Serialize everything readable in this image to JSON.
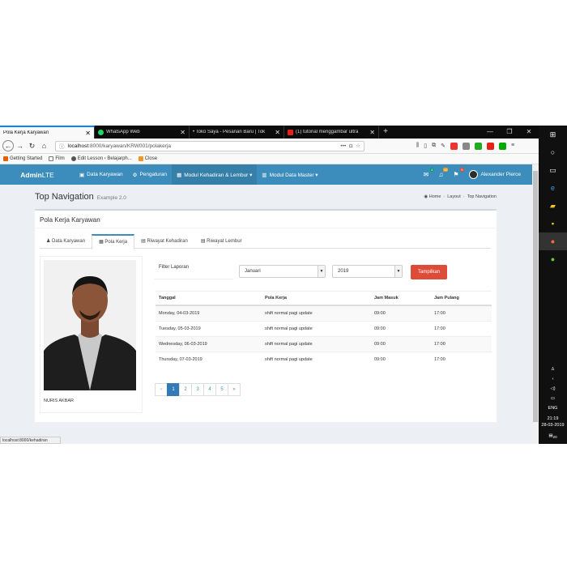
{
  "browser": {
    "tabs": [
      {
        "label": "Pola Kerja Karyawan",
        "active": true
      },
      {
        "label": "WhatsApp Web",
        "active": false
      },
      {
        "label": "• Toko Saya - Pesanan Baru | Tok",
        "active": false
      },
      {
        "label": "(1) tutorial menggambar ultra",
        "active": false
      }
    ],
    "url_host": "localhost",
    "url_path": ":8000/karyawan/KRW001/polakerja",
    "url_menu": "•••",
    "bookmarks": [
      "Getting Started",
      "Film",
      "Edit Lesson ‹ Belajarph...",
      "Close"
    ]
  },
  "header": {
    "logo_bold": "Admin",
    "logo_rest": "LTE",
    "menu": [
      {
        "label": "Data Karyawan",
        "active": false
      },
      {
        "label": "Pengaturan",
        "active": false
      },
      {
        "label": "Modul Kehadiran & Lembur ▾",
        "active": true
      },
      {
        "label": "Modul Data Master ▾",
        "active": false
      }
    ],
    "badges": {
      "mail": "4",
      "bell": "10",
      "flag": "9"
    },
    "user": "Alexander Pierce"
  },
  "page": {
    "title": "Top Navigation",
    "subtitle": "Example 2.0",
    "breadcrumb": [
      "Home",
      "Layout",
      "Top Navigation"
    ]
  },
  "box": {
    "title": "Pola Kerja Karyawan",
    "tabs": [
      {
        "label": "Data Karyawan",
        "active": false
      },
      {
        "label": "Pola Kerja",
        "active": true
      },
      {
        "label": "Riwayat Kehadiran",
        "active": false
      },
      {
        "label": "Riwayat Lembur",
        "active": false
      }
    ],
    "employee_name": "NURIS AKBAR",
    "filter_label": "Filter Laporan",
    "month": "Januari",
    "year": "2019",
    "show_button": "Tampilkan",
    "table": {
      "headers": [
        "Tanggal",
        "Pola Kerja",
        "Jam Masuk",
        "Jam Pulang"
      ],
      "rows": [
        [
          "Monday, 04-03-2019",
          "shift normal pagi update",
          "09:00",
          "17:00"
        ],
        [
          "Tuesday, 05-03-2019",
          "shift normal pagi update",
          "09:00",
          "17:00"
        ],
        [
          "Wednesday, 06-03-2019",
          "shift normal pagi update",
          "09:00",
          "17:00"
        ],
        [
          "Thursday, 07-03-2019",
          "shift normal pagi update",
          "09:00",
          "17:00"
        ]
      ]
    },
    "pagination": [
      "«",
      "1",
      "2",
      "3",
      "4",
      "5",
      "»"
    ]
  },
  "status_url": "localhost:8000/kehadiran",
  "taskbar": {
    "lang": "ENG",
    "time": "21:19",
    "date": "28-03-2019",
    "notif": "20"
  },
  "colors": {
    "header": "#3c8dbc",
    "header_active": "#367fa9",
    "button": "#dd4b39",
    "page_bg": "#ecf0f5"
  }
}
